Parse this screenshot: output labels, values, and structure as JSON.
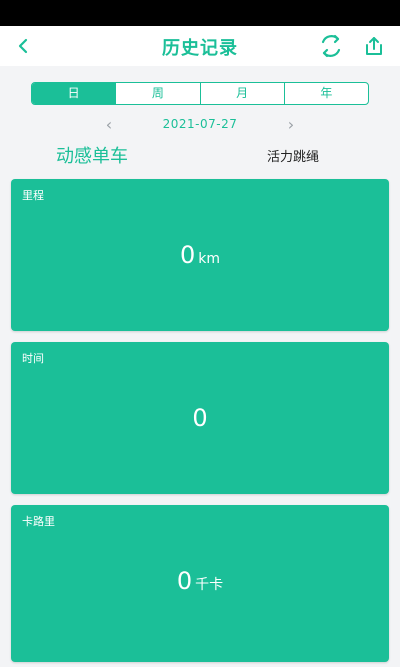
{
  "header": {
    "title": "历史记录",
    "back_icon": "chevron-left-icon",
    "refresh_icon": "refresh-icon",
    "share_icon": "share-icon",
    "accent_color": "#1bbf98"
  },
  "period_tabs": [
    {
      "label": "日",
      "active": true
    },
    {
      "label": "周",
      "active": false
    },
    {
      "label": "月",
      "active": false
    },
    {
      "label": "年",
      "active": false
    }
  ],
  "date_nav": {
    "date": "2021-07-27",
    "prev_icon": "chevron-left-icon",
    "next_icon": "chevron-right-icon"
  },
  "sport_types": {
    "active": "动感单车",
    "other": "活力跳绳"
  },
  "cards": [
    {
      "label": "里程",
      "value": "0",
      "unit": "km"
    },
    {
      "label": "时间",
      "value": "0",
      "unit": ""
    },
    {
      "label": "卡路里",
      "value": "0",
      "unit": "千卡"
    }
  ]
}
